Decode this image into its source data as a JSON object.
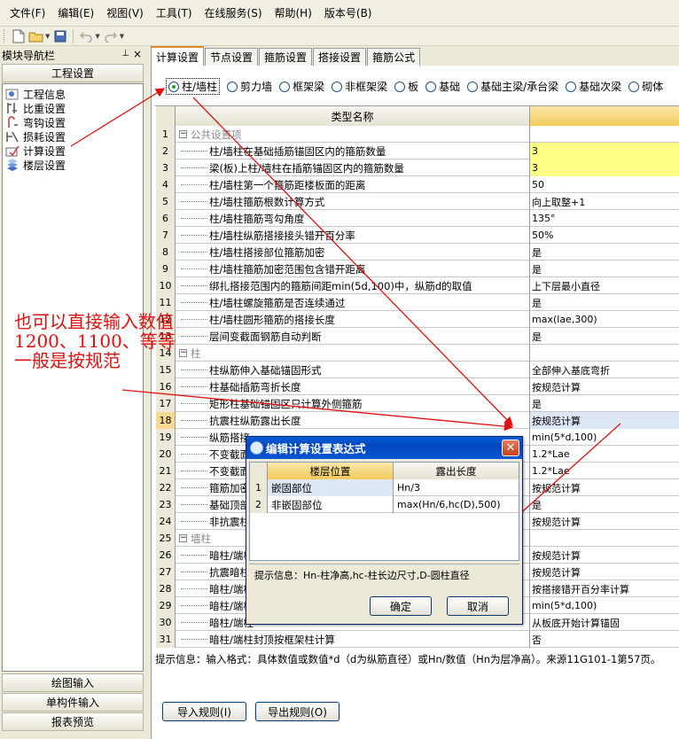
{
  "menu": [
    "文件(F)",
    "编辑(E)",
    "视图(V)",
    "工具(T)",
    "在线服务(S)",
    "帮助(H)",
    "版本号(B)"
  ],
  "left_pane": {
    "title": "模块导航栏",
    "pin": "⊥",
    "close": "×",
    "section": "工程设置",
    "items": [
      "工程信息",
      "比重设置",
      "弯钩设置",
      "损耗设置",
      "计算设置",
      "楼层设置"
    ],
    "bottom_buttons": [
      "绘图输入",
      "单构件输入",
      "报表预览"
    ]
  },
  "tabs": [
    "计算设置",
    "节点设置",
    "箍筋设置",
    "搭接设置",
    "箍筋公式"
  ],
  "radios": [
    "柱/墙柱",
    "剪力墙",
    "框架梁",
    "非框架梁",
    "板",
    "基础",
    "基础主梁/承台梁",
    "基础次梁",
    "砌体"
  ],
  "grid": {
    "header": "类型名称",
    "rows": [
      {
        "n": "1",
        "name": "公共设置项",
        "value": "",
        "group": true
      },
      {
        "n": "2",
        "name": "柱/墙柱在基础插筋锚固区内的箍筋数量",
        "value": "3"
      },
      {
        "n": "3",
        "name": "梁(板)上柱/墙柱在插筋锚固区内的箍筋数量",
        "value": "3"
      },
      {
        "n": "4",
        "name": "柱/墙柱第一个箍筋距楼板面的距离",
        "value": "50"
      },
      {
        "n": "5",
        "name": "柱/墙柱箍筋根数计算方式",
        "value": "向上取整+1"
      },
      {
        "n": "6",
        "name": "柱/墙柱箍筋弯勾角度",
        "value": "135°"
      },
      {
        "n": "7",
        "name": "柱/墙柱纵筋搭接接头错开百分率",
        "value": "50%"
      },
      {
        "n": "8",
        "name": "柱/墙柱搭接部位箍筋加密",
        "value": "是"
      },
      {
        "n": "9",
        "name": "柱/墙柱箍筋加密范围包含错开距离",
        "value": "是"
      },
      {
        "n": "10",
        "name": "绑扎搭接范围内的箍筋间距min(5d,100)中，纵筋d的取值",
        "value": "上下层最小直径"
      },
      {
        "n": "11",
        "name": "柱/墙柱螺旋箍筋是否连续通过",
        "value": "是"
      },
      {
        "n": "12",
        "name": "柱/墙柱圆形箍筋的搭接长度",
        "value": "max(lae,300)"
      },
      {
        "n": "13",
        "name": "层间变截面钢筋自动判断",
        "value": "是"
      },
      {
        "n": "14",
        "name": "柱",
        "value": "",
        "group": true
      },
      {
        "n": "15",
        "name": "柱纵筋伸入基础锚固形式",
        "value": "全部伸入基底弯折"
      },
      {
        "n": "16",
        "name": "柱基础插筋弯折长度",
        "value": "按规范计算"
      },
      {
        "n": "17",
        "name": "矩形柱基础锚固区只计算外侧箍筋",
        "value": "是"
      },
      {
        "n": "18",
        "name": "抗震柱纵筋露出长度",
        "value": "按规范计算"
      },
      {
        "n": "19",
        "name": "纵筋搭接",
        "value": "min(5*d,100)"
      },
      {
        "n": "20",
        "name": "不变截面",
        "value": "1.2*Lae"
      },
      {
        "n": "21",
        "name": "不变截面",
        "value": "1.2*Lae"
      },
      {
        "n": "22",
        "name": "箍筋加密",
        "value": "按规范计算"
      },
      {
        "n": "23",
        "name": "基础顶部",
        "value": "是"
      },
      {
        "n": "24",
        "name": "非抗震柱",
        "value": "按规范计算"
      },
      {
        "n": "25",
        "name": "墙柱",
        "value": "",
        "group": true
      },
      {
        "n": "26",
        "name": "暗柱/端柱",
        "value": "按规范计算"
      },
      {
        "n": "27",
        "name": "抗震暗柱",
        "value": "按规范计算"
      },
      {
        "n": "28",
        "name": "暗柱/端柱",
        "value": "按搭接错开百分率计算"
      },
      {
        "n": "29",
        "name": "暗柱/端柱",
        "value": "min(5*d,100)"
      },
      {
        "n": "30",
        "name": "暗柱/端柱",
        "value": "从板底开始计算锚固"
      },
      {
        "n": "31",
        "name": "暗柱/端柱封顶按框架柱计算",
        "value": "否"
      }
    ]
  },
  "hint": "提示信息：输入格式：具体数值或数值*d（d为纵筋直径）或Hn/数值（Hn为层净高）。来源11G101-1第57页。",
  "buttons": {
    "import": "导入规则(I)",
    "export": "导出规则(O)"
  },
  "dialog": {
    "title": "编辑计算设置表达式",
    "col1": "楼层位置",
    "col2": "露出长度",
    "rows": [
      {
        "n": "1",
        "pos": "嵌固部位",
        "len": "Hn/3"
      },
      {
        "n": "2",
        "pos": "非嵌固部位",
        "len": "max(Hn/6,hc(D),500)"
      }
    ],
    "hint": "提示信息：Hn-柱净高,hc-柱长边尺寸,D-圆柱直径",
    "ok": "确定",
    "cancel": "取消"
  },
  "annotation": [
    "也可以直接输入数值",
    "1200、1100、等等",
    "一般是按规范"
  ]
}
